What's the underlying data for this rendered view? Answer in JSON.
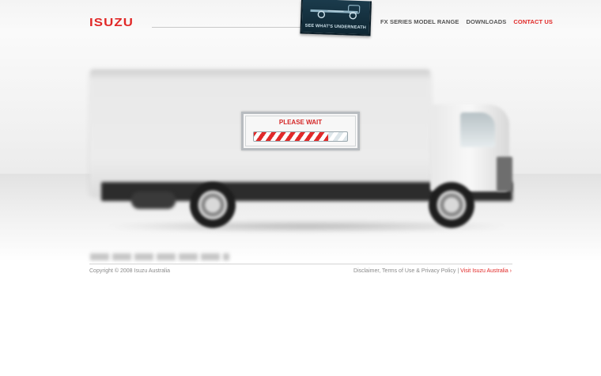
{
  "header": {
    "logo_text": "ISUZU",
    "promo_label": "SEE WHAT'S UNDERNEATH",
    "nav": [
      {
        "label": "FX SERIES MODEL RANGE",
        "active": false
      },
      {
        "label": "DOWNLOADS",
        "active": false
      },
      {
        "label": "CONTACT US",
        "active": true
      }
    ]
  },
  "loader": {
    "title": "PLEASE WAIT",
    "progress": 0.8
  },
  "footer": {
    "copyright": "Copyright © 2008 Isuzu Australia",
    "legal_links": "Disclaimer, Terms of Use & Privacy Policy",
    "separator": "|",
    "visit_link": "Visit Isuzu Australia ›"
  },
  "colors": {
    "brand_red": "#e12827",
    "nav_gray": "#555555",
    "footer_gray": "#8a8a8a"
  },
  "icons": [
    "truck-chassis-icon"
  ]
}
